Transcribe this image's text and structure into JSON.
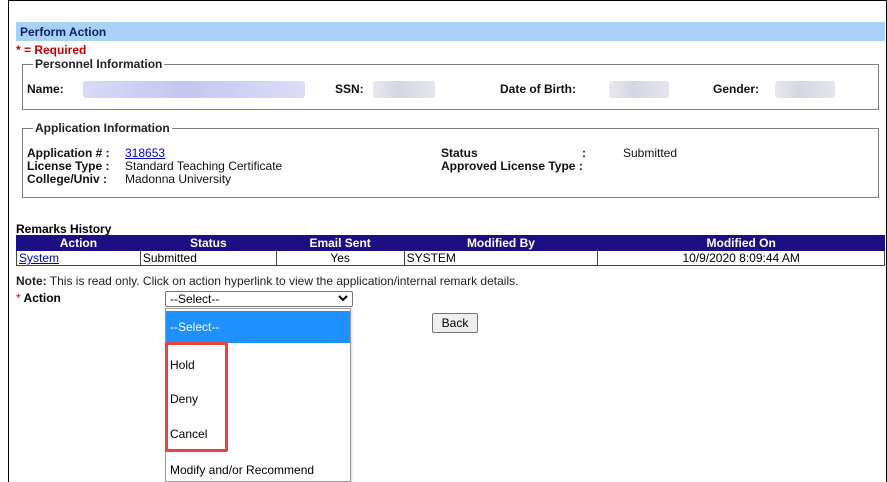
{
  "section": {
    "title": "Perform Action",
    "required_note": "* = Required"
  },
  "personnel": {
    "legend": "Personnel Information",
    "name_label": "Name:",
    "ssn_label": "SSN:",
    "dob_label": "Date of Birth:",
    "gender_label": "Gender:"
  },
  "application": {
    "legend": "Application Information",
    "app_no_label": "Application # :",
    "app_no_value": "318653",
    "license_type_label": "License Type :",
    "license_type_value": "Standard Teaching Certificate",
    "college_label": "College/Univ :",
    "college_value": "Madonna University",
    "status_label": "Status",
    "status_colon": ":",
    "status_value": "Submitted",
    "approved_label": "Approved License Type :"
  },
  "remarks": {
    "title": "Remarks History",
    "columns": [
      "Action",
      "Status",
      "Email Sent",
      "Modified By",
      "Modified On"
    ],
    "rows": [
      {
        "action": "System",
        "status": "Submitted",
        "email_sent": "Yes",
        "modified_by": "SYSTEM",
        "modified_on": "10/9/2020 8:09:44 AM"
      }
    ],
    "note_bold": "Note:",
    "note_text": " This is read only. Click on action hyperlink to view the application/internal remark details."
  },
  "action": {
    "star": "*",
    "label": " Action",
    "selected": "--Select--",
    "options": [
      "--Select--",
      "Hold",
      "Deny",
      "Cancel",
      "Modify and/or Recommend"
    ]
  },
  "buttons": {
    "back": "Back"
  },
  "icons": {
    "select_chevron": "chevron-down-icon"
  },
  "colors": {
    "header_bg": "#a9d0f5",
    "table_header_bg": "#1c0f86",
    "highlight": "#e8433f",
    "selected_option": "#1e90ff"
  }
}
